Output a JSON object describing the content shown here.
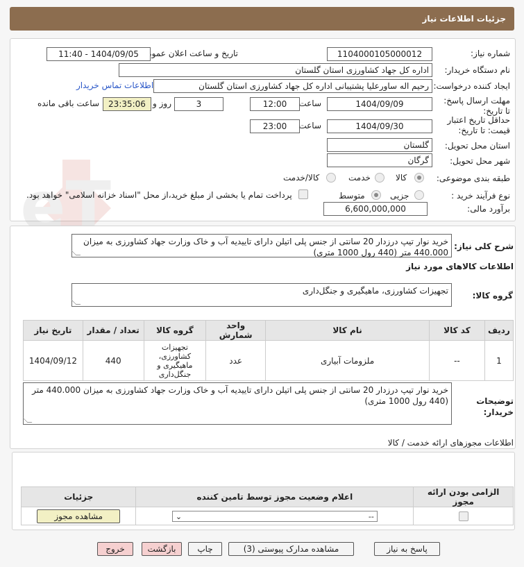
{
  "header": {
    "title": "جزئیات اطلاعات نیاز"
  },
  "form": {
    "need_number_label": "شماره نیاز:",
    "need_number": "1104000105000012",
    "announce_label": "تاریخ و ساعت اعلان عمومی:",
    "announce_value": "1404/09/05 - 11:40",
    "buyer_org_label": "نام دستگاه خریدار:",
    "buyer_org": "اداره کل جهاد کشاورزی استان گلستان",
    "creator_label": "ایجاد کننده درخواست:",
    "creator": "رحیم اله ساورعلیا پشتیبانی اداره کل جهاد کشاورزی استان گلستان",
    "contact_link": "اطلاعات تماس خریدار",
    "deadline_label": "مهلت ارسال پاسخ: تا تاریخ:",
    "deadline_date": "1404/09/09",
    "time_label": "ساعت",
    "deadline_time": "12:00",
    "days_value": "3",
    "days_label": "روز و",
    "remaining_time": "23:35:06",
    "remaining_label": "ساعت باقی مانده",
    "validity_label": "حداقل تاریخ اعتبار قیمت: تا تاریخ:",
    "validity_date": "1404/09/30",
    "validity_time": "23:00",
    "province_label": "استان محل تحویل:",
    "province": "گلستان",
    "city_label": "شهر محل تحویل:",
    "city": "گرگان",
    "category_label": "طبقه بندی موضوعی:",
    "category_options": [
      "کالا",
      "خدمت",
      "کالا/خدمت"
    ],
    "purchase_type_label": "نوع فرآیند خرید :",
    "purchase_options": [
      "جزیی",
      "متوسط"
    ],
    "payment_note": "پرداخت تمام یا بخشی از مبلغ خرید،از محل \"اسناد خزانه اسلامی\" خواهد بود.",
    "budget_label": "برآورد مالی:",
    "budget": "6,600,000,000"
  },
  "description": {
    "label": "شرح کلی نیاز:",
    "text": "خرید نوار تیپ درزدار 20 سانتی از جنس پلی اتیلن دارای تاییدیه آب و خاک وزارت جهاد کشاورزی به میزان 440.000 متر (440 رول 1000 متری)"
  },
  "goods": {
    "section_title": "اطلاعات کالاهای مورد نیاز",
    "group_label": "گروه کالا:",
    "group_value": "تجهیزات کشاورزی، ماهیگیری و جنگل‌داری",
    "columns": [
      "ردیف",
      "کد کالا",
      "نام کالا",
      "واحد شمارش",
      "گروه کالا",
      "تعداد / مقدار",
      "تاریخ نیاز"
    ],
    "rows": [
      {
        "index": "1",
        "code": "--",
        "name": "ملزومات آبیاری",
        "unit": "عدد",
        "group": "تجهیزات کشاورزی، ماهیگیری و جنگل‌داری",
        "qty": "440",
        "date": "1404/09/12"
      }
    ]
  },
  "buyer_notes": {
    "label": "توضیحات خریدار:",
    "text": "خرید نوار تیپ درزدار 20 سانتی از جنس پلی اتیلن دارای تاییدیه آب و خاک وزارت جهاد کشاورزی به میزان 440.000 متر (440 رول 1000 متری)"
  },
  "permits": {
    "section_title": "اطلاعات مجوزهای ارائه خدمت / کالا",
    "columns": [
      "الزامی بودن ارائه مجوز",
      "اعلام وضعیت مجوز توسط تامین کننده",
      "جزئیات"
    ],
    "select_value": "--",
    "view_button": "مشاهده مجوز"
  },
  "actions": {
    "reply": "پاسخ به نیاز",
    "attachments": "مشاهده مدارک پیوستی (3)",
    "print": "چاپ",
    "back": "بازگشت",
    "exit": "خروج"
  },
  "colors": {
    "header": "#8c6d4f",
    "accent_link": "#2a57c8",
    "highlight": "#f2f0c4"
  }
}
